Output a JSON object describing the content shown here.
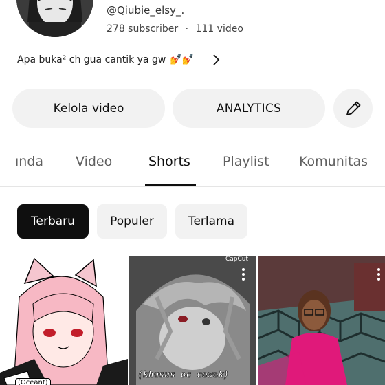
{
  "channel": {
    "handle": "@Qiubie_elsy_.",
    "subscribers": "278 subscriber",
    "separator": "·",
    "videos": "111 video",
    "bio": "Apa buka² ch gua cantik ya gw",
    "bio_emoji": "💅💅"
  },
  "actions": {
    "manage_label": "Kelola video",
    "analytics_label": "ANALYTICS",
    "edit_icon": "pencil-icon"
  },
  "tabs": [
    {
      "label": "ında",
      "active": false
    },
    {
      "label": "Video",
      "active": false
    },
    {
      "label": "Shorts",
      "active": true
    },
    {
      "label": "Playlist",
      "active": false
    },
    {
      "label": "Komunitas",
      "active": false
    }
  ],
  "filters": [
    {
      "label": "Terbaru",
      "active": true
    },
    {
      "label": "Populer",
      "active": false
    },
    {
      "label": "Terlama",
      "active": false
    }
  ],
  "shorts": [
    {
      "overlay": "(Oceant)"
    },
    {
      "overlay": "(khusus oc cewek)",
      "badge": "CapCut"
    },
    {
      "overlay": ""
    }
  ],
  "colors": {
    "active_chip_bg": "#0f0f0f",
    "button_bg": "#f2f2f2",
    "text": "#0f0f0f",
    "secondary_text": "#606060"
  }
}
